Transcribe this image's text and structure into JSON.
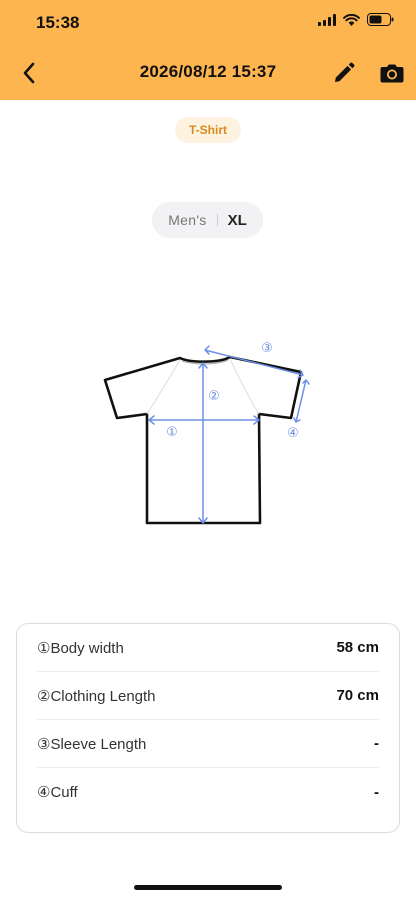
{
  "status_bar": {
    "time": "15:38"
  },
  "nav": {
    "title": "2026/08/12 15:37"
  },
  "category": "T-Shirt",
  "size": {
    "gender": "Men's",
    "value": "XL"
  },
  "diagram": {
    "markers": [
      "①",
      "②",
      "③",
      "④"
    ]
  },
  "measurements": [
    {
      "label": "①Body width",
      "value": "58 cm"
    },
    {
      "label": "②Clothing Length",
      "value": "70 cm"
    },
    {
      "label": "③Sleeve Length",
      "value": "-"
    },
    {
      "label": "④Cuff",
      "value": "-"
    }
  ],
  "colors": {
    "header": "#FDB54F",
    "chip_bg": "#FEF2E0",
    "chip_text": "#D98A1F",
    "measure_line": "#6D8FE6"
  },
  "icons": [
    "back-icon",
    "edit-icon",
    "camera-icon",
    "signal-icon",
    "wifi-icon",
    "battery-icon"
  ]
}
